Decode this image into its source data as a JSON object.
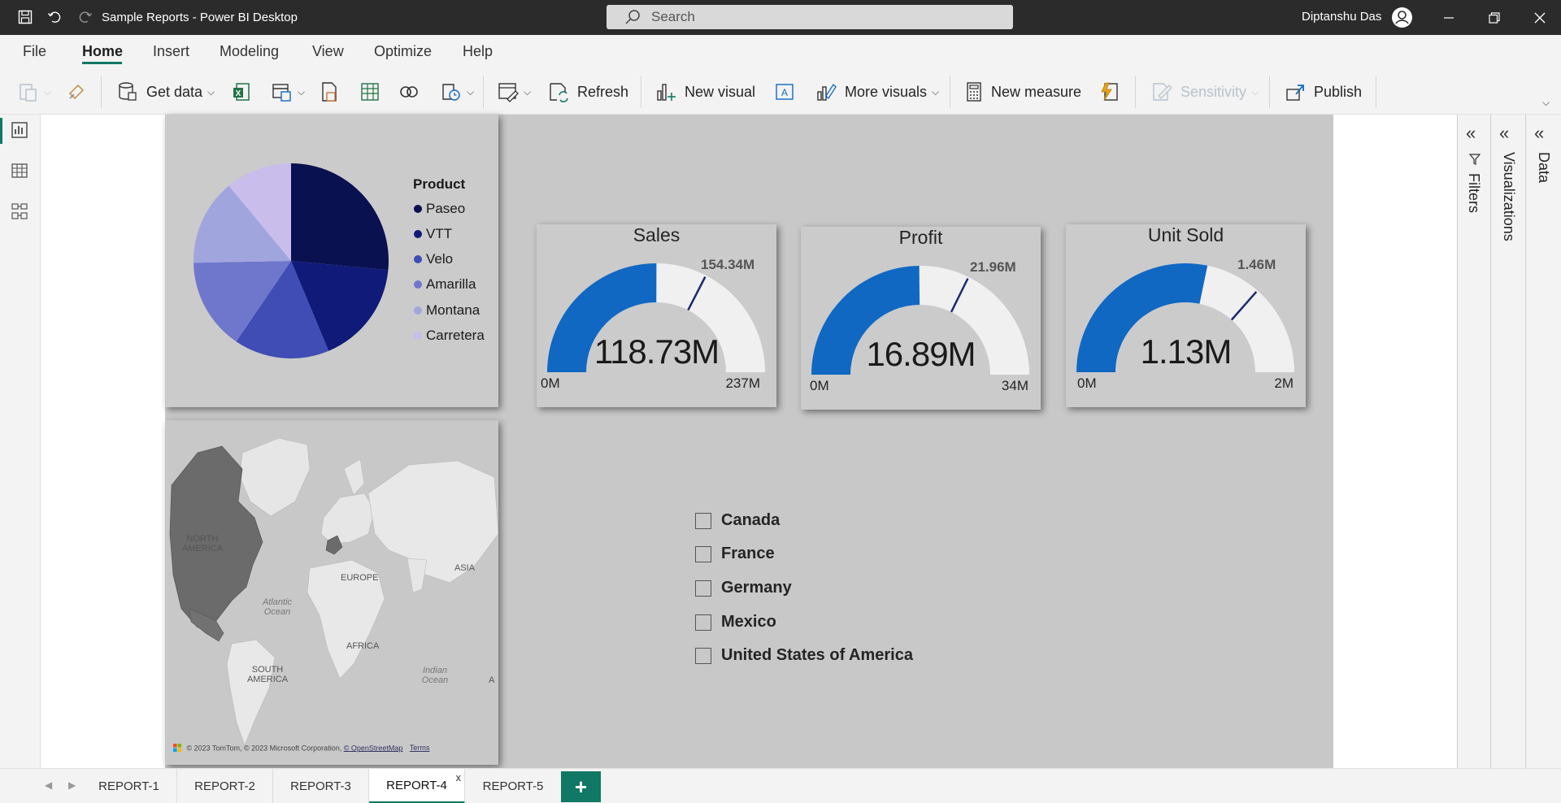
{
  "titlebar": {
    "title": "Sample Reports - Power BI Desktop",
    "search_placeholder": "Search",
    "user_name": "Diptanshu Das"
  },
  "menu": {
    "tabs": [
      "File",
      "Home",
      "Insert",
      "Modeling",
      "View",
      "Optimize",
      "Help"
    ],
    "active": "Home"
  },
  "ribbon": {
    "get_data": "Get data",
    "refresh": "Refresh",
    "new_visual": "New visual",
    "more_visuals": "More visuals",
    "new_measure": "New measure",
    "sensitivity": "Sensitivity",
    "publish": "Publish"
  },
  "pie": {
    "legend_title": "Product",
    "items": [
      {
        "label": "Paseo",
        "color": "#0a1150"
      },
      {
        "label": "VTT",
        "color": "#101a78"
      },
      {
        "label": "Velo",
        "color": "#3f4db5"
      },
      {
        "label": "Amarilla",
        "color": "#6f77cc"
      },
      {
        "label": "Montana",
        "color": "#a0a6dd"
      },
      {
        "label": "Carretera",
        "color": "#c9bdeb"
      }
    ]
  },
  "chart_data": [
    {
      "type": "pie",
      "title": "",
      "categories": [
        "Paseo",
        "VTT",
        "Velo",
        "Amarilla",
        "Montana",
        "Carretera"
      ],
      "values": [
        26.5,
        17.2,
        15.8,
        15.2,
        14.3,
        11.0
      ],
      "legend": "right",
      "legend_title": "Product"
    },
    {
      "type": "gauge",
      "title": "Sales",
      "value": 118.73,
      "value_label": "118.73M",
      "target": 154.34,
      "target_label": "154.34M",
      "min_label": "0M",
      "max_label": "237M",
      "range": [
        0,
        237
      ]
    },
    {
      "type": "gauge",
      "title": "Profit",
      "value": 16.89,
      "value_label": "16.89M",
      "target": 21.96,
      "target_label": "21.96M",
      "min_label": "0M",
      "max_label": "34M",
      "range": [
        0,
        34
      ]
    },
    {
      "type": "gauge",
      "title": "Unit Sold",
      "value": 1.13,
      "value_label": "1.13M",
      "target": 1.46,
      "target_label": "1.46M",
      "min_label": "0M",
      "max_label": "2M",
      "range": [
        0,
        2
      ]
    }
  ],
  "map": {
    "labels": [
      "NORTH AMERICA",
      "EUROPE",
      "ASIA",
      "AFRICA",
      "SOUTH AMERICA",
      "Atlantic Ocean",
      "Indian Ocean",
      "A"
    ],
    "attribution": "© 2023 TomTom, © 2023 Microsoft Corporation,",
    "osm": "© OpenStreetMap",
    "terms": "Terms"
  },
  "slicer": {
    "items": [
      "Canada",
      "France",
      "Germany",
      "Mexico",
      "United States of America"
    ]
  },
  "panes": {
    "filters": "Filters",
    "visualizations": "Visualizations",
    "data": "Data"
  },
  "pages": {
    "tabs": [
      "REPORT-1",
      "REPORT-2",
      "REPORT-3",
      "REPORT-4",
      "REPORT-5"
    ],
    "active": "REPORT-4",
    "close": "x",
    "add": "+"
  },
  "colors": {
    "accent": "#117865",
    "gauge_fill": "#1068c2",
    "gauge_track": "#f0f0f0",
    "gauge_target": "#1a2a6c"
  }
}
